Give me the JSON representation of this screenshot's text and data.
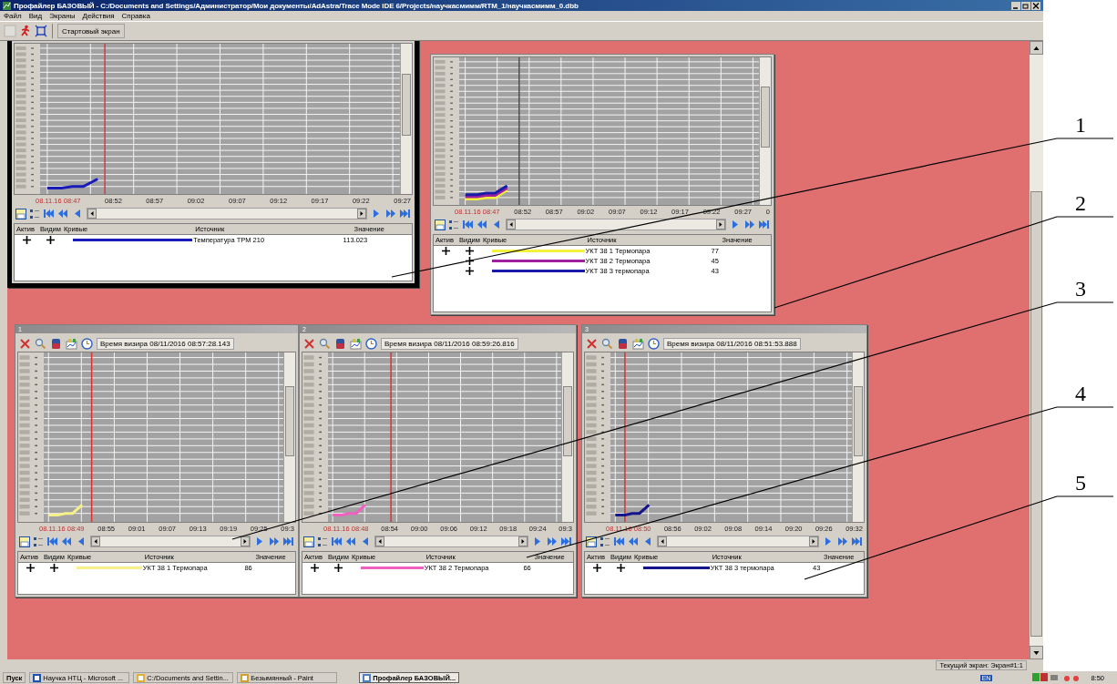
{
  "window": {
    "title": "Профайлер БАЗОВЫЙ - C:/Documents and Settings/Администратор/Мои документы/AdAstra/Trace Mode IDE 6/Projects/научкасмимм/RTM_1/научкасмимм_0.dbb"
  },
  "menu": [
    "Файл",
    "Вид",
    "Экраны",
    "Действия",
    "Справка"
  ],
  "toolbar": {
    "start_screen_button": "Стартовый экран"
  },
  "panels": [
    {
      "selected": true,
      "x_labels": [
        "08.11.16 08:47",
        "08:52",
        "08:57",
        "09:02",
        "09:07",
        "09:12",
        "09:17",
        "09:22",
        "09:27"
      ],
      "legend_columns": [
        "Актив",
        "Видим",
        "Кривые",
        "Источник",
        "Значение"
      ],
      "curves": [
        {
          "active": true,
          "visible": true,
          "color": "#1a1ab8",
          "source": "Температура ТРМ 210",
          "value": "113.023"
        }
      ]
    },
    {
      "selected": false,
      "x_labels": [
        "08.11.16 08:47",
        "08:52",
        "08:57",
        "09:02",
        "09:07",
        "09:12",
        "09:17",
        "09:22",
        "09:27",
        "0"
      ],
      "legend_columns": [
        "Актив",
        "Видим",
        "Кривые",
        "Источник",
        "Значение"
      ],
      "curves": [
        {
          "active": true,
          "visible": true,
          "color": "#f5f03c",
          "source": "УКТ 38 1 Термопара",
          "value": "77"
        },
        {
          "active": false,
          "visible": true,
          "color": "#a020a0",
          "source": "УКТ 38 2 Термопара",
          "value": "45"
        },
        {
          "active": false,
          "visible": true,
          "color": "#1a1aa8",
          "source": "УКТ 38 3 термопара",
          "value": "43"
        }
      ]
    },
    {
      "selected": false,
      "title": "1",
      "cursor_time": "Время визира 08/11/2016 08:57:28.143",
      "x_labels": [
        "08.11.16 08:49",
        "08:55",
        "09:01",
        "09:07",
        "09:13",
        "09:19",
        "09:25",
        "09:3"
      ],
      "legend_columns": [
        "Актив",
        "Видим",
        "Кривые",
        "Источник",
        "Значение"
      ],
      "curves": [
        {
          "active": true,
          "visible": true,
          "color": "#f7f08a",
          "source": "УКТ 38 1 Термопара",
          "value": "86"
        }
      ]
    },
    {
      "selected": false,
      "title": "2",
      "cursor_time": "Время визира 08/11/2016 08:59:26.816",
      "x_labels": [
        "08.11.16 08:48",
        "08:54",
        "09:00",
        "09:06",
        "09:12",
        "09:18",
        "09:24",
        "09:3"
      ],
      "legend_columns": [
        "Актив",
        "Видим",
        "Кривые",
        "Источник",
        "Значение"
      ],
      "curves": [
        {
          "active": true,
          "visible": true,
          "color": "#f060c0",
          "source": "УКТ 38 2 Термопара",
          "value": "66"
        }
      ]
    },
    {
      "selected": false,
      "title": "3",
      "cursor_time": "Время визира 08/11/2016 08:51:53.888",
      "x_labels": [
        "08.11.16 08:50",
        "08:56",
        "09:02",
        "09:08",
        "09:14",
        "09:20",
        "09:26",
        "09:32"
      ],
      "legend_columns": [
        "Актив",
        "Видим",
        "Кривые",
        "Источник",
        "Значение"
      ],
      "curves": [
        {
          "active": true,
          "visible": true,
          "color": "#14148c",
          "source": "УКТ 38 3 термопара",
          "value": "43"
        }
      ]
    }
  ],
  "annotations": [
    {
      "label": "1"
    },
    {
      "label": "2"
    },
    {
      "label": "3"
    },
    {
      "label": "4"
    },
    {
      "label": "5"
    }
  ],
  "status_bar": {
    "text": "Текущий экран: Экран#1:1"
  },
  "taskbar": {
    "start": "Пуск",
    "tasks": [
      {
        "label": "Научка НТЦ - Microsoft ...",
        "selected": false
      },
      {
        "label": "C:/Documents and Settin...",
        "selected": false
      },
      {
        "label": "Безымянный - Paint",
        "selected": false
      },
      {
        "label": "Профайлер БАЗОВЫЙ...",
        "selected": true
      }
    ],
    "language": "EN",
    "clock": "8:50"
  }
}
